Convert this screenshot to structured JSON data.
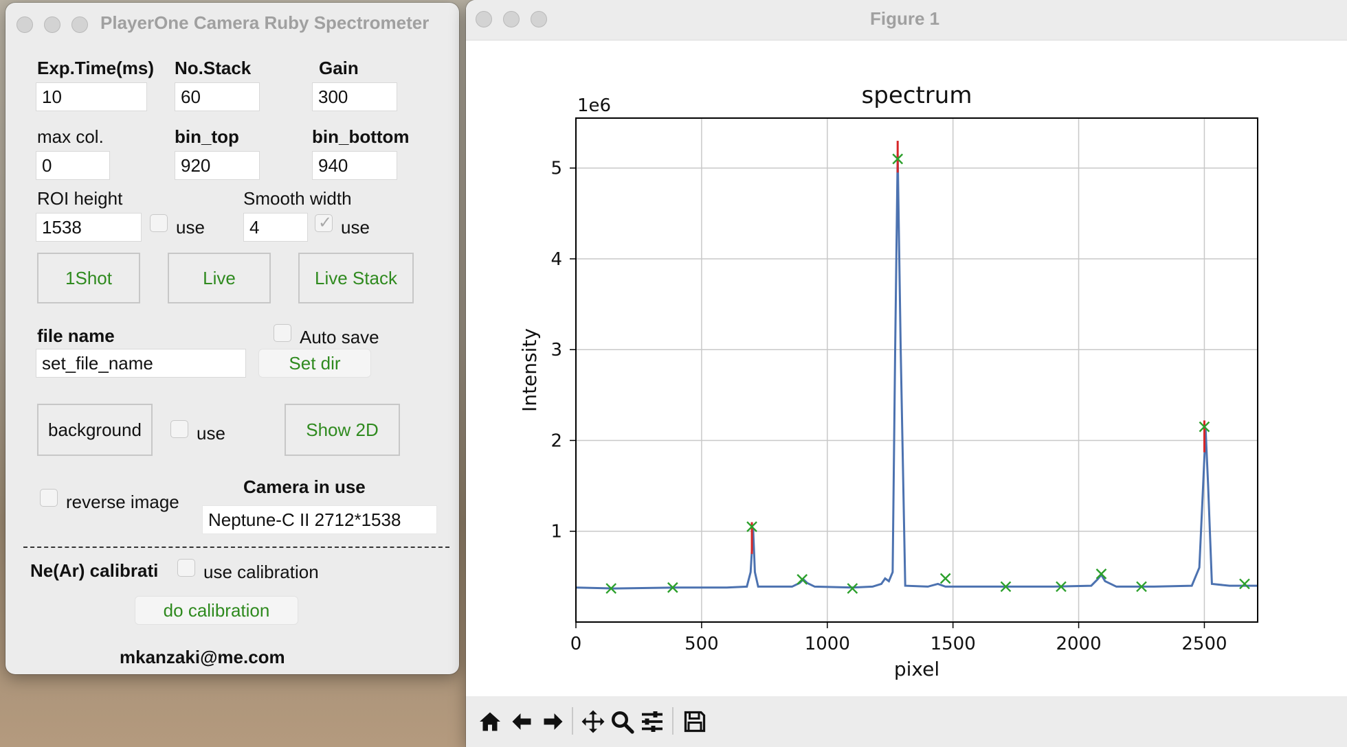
{
  "panel": {
    "title": "PlayerOne Camera Ruby Spectrometer",
    "exp_label": "Exp.Time(ms)",
    "exp_value": "10",
    "stack_label": "No.Stack",
    "stack_value": "60",
    "gain_label": "Gain",
    "gain_value": "300",
    "maxcol_label": "max col.",
    "maxcol_value": "0",
    "bintop_label": "bin_top",
    "bintop_value": "920",
    "binbottom_label": "bin_bottom",
    "binbottom_value": "940",
    "roi_label": "ROI height",
    "roi_value": "1538",
    "roi_use_label": "use",
    "roi_use_checked": false,
    "smooth_label": "Smooth width",
    "smooth_value": "4",
    "smooth_use_label": "use",
    "smooth_use_checked": true,
    "oneshot_label": "1Shot",
    "live_label": "Live",
    "livestack_label": "Live Stack",
    "filename_label": "file name",
    "autosave_label": "Auto save",
    "filename_value": "set_file_name",
    "setdir_label": "Set dir",
    "background_label": "background",
    "bg_use_label": "use",
    "show2d_label": "Show 2D",
    "reverse_label": "reverse image",
    "camera_label": "Camera in use",
    "camera_value": "Neptune-C II 2712*1538",
    "calib_label": "Ne(Ar) calibrati",
    "use_calib_label": "use calibration",
    "do_calib_label": "do calibration",
    "email": "mkanzaki@me.com"
  },
  "figure": {
    "window_title": "Figure 1",
    "toolbar_icons": [
      "home-icon",
      "back-arrow-icon",
      "forward-arrow-icon",
      "pan-icon",
      "zoom-icon",
      "configure-subplots-icon",
      "save-icon"
    ]
  },
  "chart_data": {
    "type": "line",
    "title": "spectrum",
    "xlabel": "pixel",
    "ylabel": "Intensity",
    "offset_text": "1e6",
    "xlim": [
      0,
      2712
    ],
    "ylim": [
      0,
      5.55
    ],
    "xticks": [
      0,
      500,
      1000,
      1500,
      2000,
      2500
    ],
    "yticks": [
      1,
      2,
      3,
      4,
      5
    ],
    "grid": true,
    "colors": {
      "line": "#4c72b0",
      "raw": "#d62728",
      "marker": "#2ca02c"
    },
    "series": [
      {
        "style": "line",
        "x": [
          0,
          150,
          400,
          600,
          680,
          695,
          705,
          712,
          725,
          860,
          890,
          905,
          920,
          950,
          1100,
          1180,
          1215,
          1230,
          1245,
          1260,
          1270,
          1280,
          1292,
          1310,
          1400,
          1440,
          1470,
          1490,
          1700,
          1900,
          2050,
          2075,
          2090,
          2105,
          2150,
          2300,
          2450,
          2480,
          2495,
          2505,
          2515,
          2530,
          2600,
          2660,
          2712
        ],
        "y": [
          0.38,
          0.37,
          0.38,
          0.38,
          0.39,
          0.55,
          1.02,
          0.55,
          0.39,
          0.39,
          0.43,
          0.47,
          0.43,
          0.39,
          0.38,
          0.39,
          0.42,
          0.48,
          0.45,
          0.55,
          3.0,
          5.15,
          3.0,
          0.4,
          0.39,
          0.42,
          0.39,
          0.39,
          0.39,
          0.39,
          0.4,
          0.47,
          0.52,
          0.45,
          0.39,
          0.39,
          0.4,
          0.6,
          1.5,
          2.12,
          1.5,
          0.42,
          0.4,
          0.4,
          0.4
        ]
      },
      {
        "style": "peaks",
        "x": [
          700,
          1280,
          2500
        ],
        "y": [
          1.1,
          5.3,
          2.22
        ]
      },
      {
        "style": "markers",
        "x": [
          140,
          385,
          700,
          900,
          1100,
          1280,
          1470,
          1710,
          1930,
          2090,
          2250,
          2500,
          2660
        ],
        "y": [
          0.37,
          0.38,
          1.05,
          0.47,
          0.37,
          5.1,
          0.48,
          0.39,
          0.39,
          0.53,
          0.39,
          2.15,
          0.42
        ]
      }
    ]
  }
}
